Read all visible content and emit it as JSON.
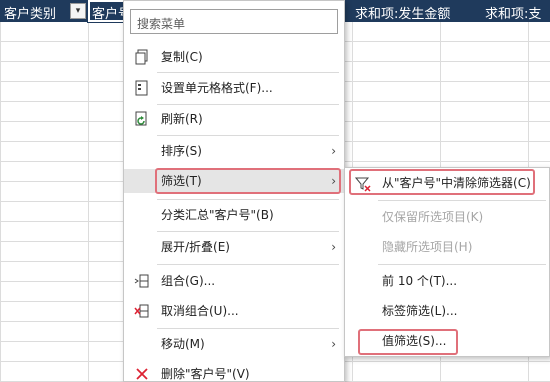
{
  "header": {
    "col1": "客户类别",
    "col2": "客户号",
    "col4": "求和项:发生金额",
    "col5": "求和项:支"
  },
  "menu": {
    "search_placeholder": "搜索菜单",
    "items": [
      {
        "label": "复制(C)",
        "icon": "copy-icon"
      },
      {
        "label": "设置单元格格式(F)...",
        "icon": "format-cells-icon"
      },
      {
        "label": "刷新(R)",
        "icon": "refresh-icon"
      },
      {
        "label": "排序(S)",
        "submenu": true
      },
      {
        "label": "筛选(T)",
        "submenu": true,
        "highlighted": true
      },
      {
        "label": "分类汇总\"客户号\"(B)"
      },
      {
        "label": "展开/折叠(E)",
        "submenu": true
      },
      {
        "label": "组合(G)...",
        "icon": "group-icon"
      },
      {
        "label": "取消组合(U)...",
        "icon": "ungroup-icon"
      },
      {
        "label": "移动(M)",
        "submenu": true
      },
      {
        "label": "删除\"客户号\"(V)",
        "icon": "delete-icon"
      }
    ]
  },
  "submenu": {
    "items": [
      {
        "label": "从\"客户号\"中清除筛选器(C)",
        "icon": "clear-filter-icon"
      },
      {
        "label": "仅保留所选项目(K)",
        "disabled": true
      },
      {
        "label": "隐藏所选项目(H)",
        "disabled": true
      },
      {
        "label": "前 10 个(T)..."
      },
      {
        "label": "标签筛选(L)..."
      },
      {
        "label": "值筛选(S)..."
      }
    ]
  },
  "colors": {
    "header_bg": "#1f3a5c",
    "highlight": "#e5e5e5",
    "annotation_box": "#e0707a"
  }
}
